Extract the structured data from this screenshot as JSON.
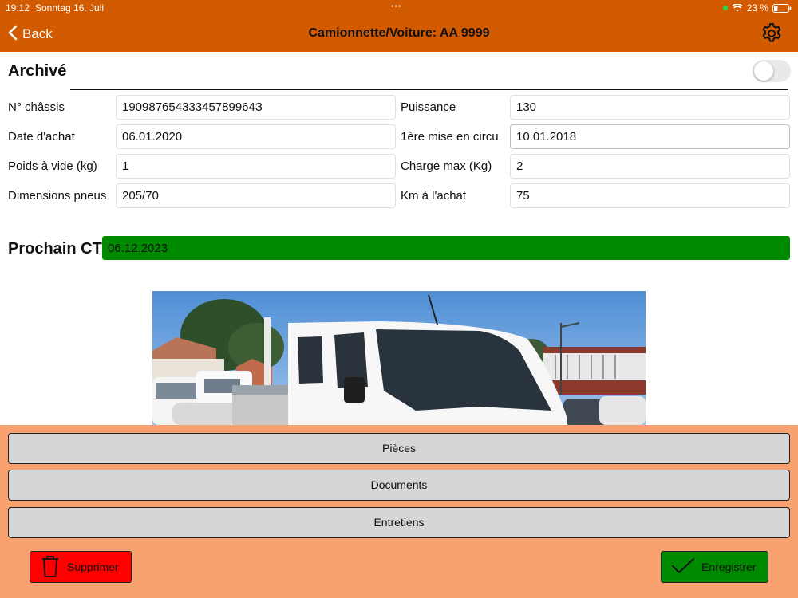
{
  "status": {
    "time": "19:12",
    "date": "Sonntag 16. Juli",
    "dots": "•••",
    "battery": "23 %"
  },
  "nav": {
    "back_label": "Back",
    "title": "Camionnette/Voiture: AA 9999"
  },
  "archive": {
    "label": "Archivé",
    "on": false
  },
  "fields": {
    "chassis": {
      "label": "N° châssis",
      "value": "19098765433345789964З"
    },
    "puissance": {
      "label": "Puissance",
      "value": "130"
    },
    "date_achat": {
      "label": "Date d'achat",
      "value": "06.01.2020"
    },
    "mise_circu": {
      "label": "1ère mise en circu.",
      "value": "10.01.2018"
    },
    "poids_vide": {
      "label": "Poids à vide (kg)",
      "value": "1"
    },
    "charge_max": {
      "label": "Charge max (Kg)",
      "value": "2"
    },
    "pneus": {
      "label": "Dimensions pneus",
      "value": "205/70"
    },
    "km_achat": {
      "label": "Km à l'achat",
      "value": "75"
    }
  },
  "ct": {
    "label": "Prochain CT",
    "value": "06.12.2023",
    "color": "#008a00"
  },
  "menu": {
    "pieces": "Pièces",
    "documents": "Documents",
    "entretiens": "Entretiens"
  },
  "actions": {
    "delete_label": "Supprimer",
    "save_label": "Enregistrer"
  },
  "colors": {
    "nav_bg": "#d25a00",
    "panel_bg": "#f8a16e",
    "delete": "#ff0000",
    "save": "#008a00"
  }
}
